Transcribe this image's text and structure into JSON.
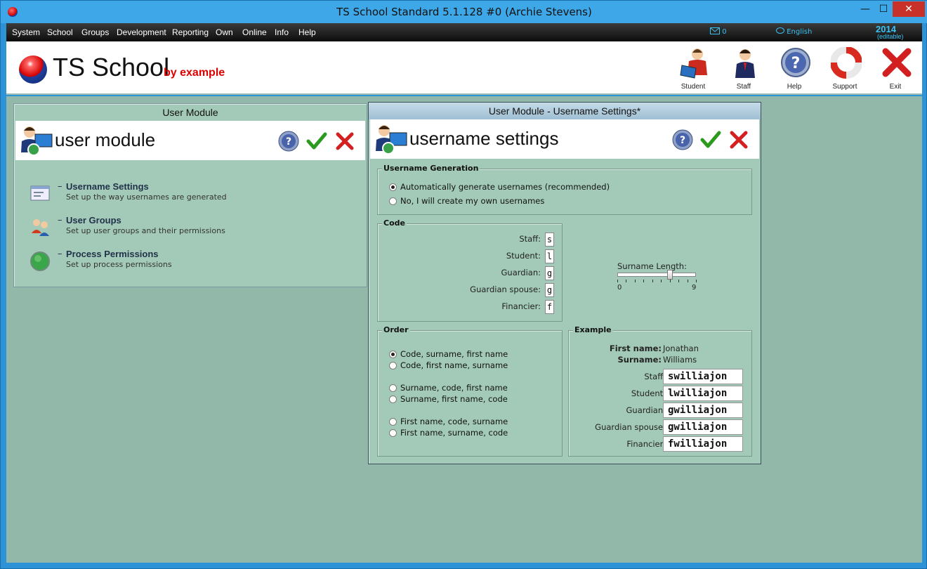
{
  "window": {
    "title": "TS School Standard 5.1.128 #0 (Archie Stevens)",
    "min": "—",
    "max": "☐",
    "close": "✕"
  },
  "menu": {
    "items": [
      "System",
      "School",
      "Groups",
      "Development",
      "Reporting",
      "Own",
      "Online",
      "Info",
      "Help"
    ],
    "mail_count": "0",
    "language": "English",
    "year": "2014",
    "edition": "(editable)"
  },
  "header": {
    "logo_text": "TS School",
    "logo_sub": "by example",
    "buttons": [
      "Student",
      "Staff",
      "Help",
      "Support",
      "Exit"
    ]
  },
  "user_module": {
    "title": "User Module",
    "heading": "user module",
    "links": [
      {
        "title": "Username Settings",
        "desc": "Set up the way usernames are generated"
      },
      {
        "title": "User Groups",
        "desc": "Set up user groups and their permissions"
      },
      {
        "title": "Process Permissions",
        "desc": "Set up process permissions"
      }
    ],
    "dash": "–"
  },
  "settings": {
    "title": "User Module - Username Settings*",
    "heading": "username settings",
    "generation": {
      "label": "Username Generation",
      "options": [
        "Automatically generate usernames (recommended)",
        "No, I will create my own usernames"
      ],
      "selected": 0
    },
    "code": {
      "label": "Code",
      "rows": [
        {
          "label": "Staff:",
          "value": "s"
        },
        {
          "label": "Student:",
          "value": "l"
        },
        {
          "label": "Guardian:",
          "value": "g"
        },
        {
          "label": "Guardian spouse:",
          "value": "g"
        },
        {
          "label": "Financier:",
          "value": "f"
        }
      ]
    },
    "surname_length": {
      "label": "Surname Length:",
      "min": "0",
      "max": "9",
      "value": 6
    },
    "order": {
      "label": "Order",
      "options": [
        "Code, surname, first name",
        "Code, first name, surname",
        "Surname, code, first name",
        "Surname, first name, code",
        "First name, code, surname",
        "First name, surname, code"
      ],
      "selected": 0
    },
    "example": {
      "label": "Example",
      "first_name_label": "First name:",
      "first_name": "Jonathan",
      "surname_label": "Surname:",
      "surname": "Williams",
      "rows": [
        {
          "label": "Staff:",
          "value": "swilliajon"
        },
        {
          "label": "Student:",
          "value": "lwilliajon"
        },
        {
          "label": "Guardian:",
          "value": "gwilliajon"
        },
        {
          "label": "Guardian spouse:",
          "value": "gwilliajon"
        },
        {
          "label": "Financier:",
          "value": "fwilliajon"
        }
      ]
    }
  },
  "colors": {
    "workspace": "#91b8a8",
    "panel": "#a3cab8",
    "menubar": "#111111",
    "accent_red": "#e00000",
    "link_blue": "#39c4f4"
  }
}
